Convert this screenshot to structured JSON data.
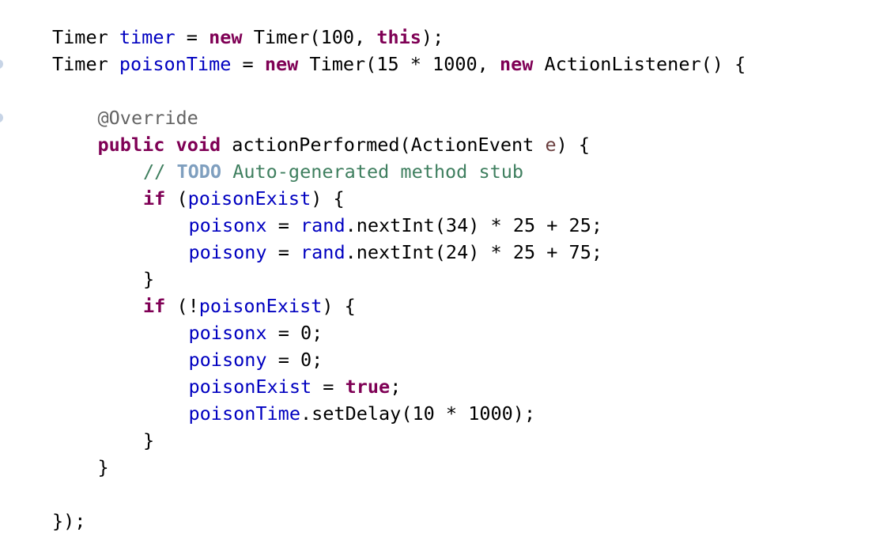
{
  "editor": {
    "lines": [
      {
        "indent": 0,
        "tokens": [
          {
            "t": "Timer ",
            "k": "plain"
          },
          {
            "t": "timer",
            "k": "field"
          },
          {
            "t": " = ",
            "k": "plain"
          },
          {
            "t": "new",
            "k": "kw"
          },
          {
            "t": " Timer(100, ",
            "k": "plain"
          },
          {
            "t": "this",
            "k": "kw"
          },
          {
            "t": ");",
            "k": "plain"
          }
        ]
      },
      {
        "indent": 0,
        "tokens": [
          {
            "t": "Timer ",
            "k": "plain"
          },
          {
            "t": "poisonTime",
            "k": "field"
          },
          {
            "t": " = ",
            "k": "plain"
          },
          {
            "t": "new",
            "k": "kw"
          },
          {
            "t": " Timer(15 * 1000, ",
            "k": "plain"
          },
          {
            "t": "new",
            "k": "kw"
          },
          {
            "t": " ActionListener() {",
            "k": "plain"
          }
        ]
      },
      {
        "indent": 0,
        "tokens": []
      },
      {
        "indent": 1,
        "tokens": [
          {
            "t": "@Override",
            "k": "ann"
          }
        ]
      },
      {
        "indent": 1,
        "tokens": [
          {
            "t": "public",
            "k": "kw"
          },
          {
            "t": " ",
            "k": "plain"
          },
          {
            "t": "void",
            "k": "kw"
          },
          {
            "t": " actionPerformed(ActionEvent ",
            "k": "plain"
          },
          {
            "t": "e",
            "k": "param"
          },
          {
            "t": ") {",
            "k": "plain"
          }
        ]
      },
      {
        "indent": 2,
        "tokens": [
          {
            "t": "// ",
            "k": "comment"
          },
          {
            "t": "TODO",
            "k": "todo"
          },
          {
            "t": " Auto-generated method stub",
            "k": "comment"
          }
        ]
      },
      {
        "indent": 2,
        "tokens": [
          {
            "t": "if",
            "k": "kw"
          },
          {
            "t": " (",
            "k": "plain"
          },
          {
            "t": "poisonExist",
            "k": "field"
          },
          {
            "t": ") {",
            "k": "plain"
          }
        ]
      },
      {
        "indent": 3,
        "tokens": [
          {
            "t": "poisonx",
            "k": "field"
          },
          {
            "t": " = ",
            "k": "plain"
          },
          {
            "t": "rand",
            "k": "field"
          },
          {
            "t": ".nextInt(34) * 25 + 25;",
            "k": "plain"
          }
        ]
      },
      {
        "indent": 3,
        "tokens": [
          {
            "t": "poisony",
            "k": "field"
          },
          {
            "t": " = ",
            "k": "plain"
          },
          {
            "t": "rand",
            "k": "field"
          },
          {
            "t": ".nextInt(24) * 25 + 75;",
            "k": "plain"
          }
        ]
      },
      {
        "indent": 2,
        "tokens": [
          {
            "t": "}",
            "k": "plain"
          }
        ]
      },
      {
        "indent": 2,
        "tokens": [
          {
            "t": "if",
            "k": "kw"
          },
          {
            "t": " (!",
            "k": "plain"
          },
          {
            "t": "poisonExist",
            "k": "field"
          },
          {
            "t": ") {",
            "k": "plain"
          }
        ]
      },
      {
        "indent": 3,
        "tokens": [
          {
            "t": "poisonx",
            "k": "field"
          },
          {
            "t": " = 0;",
            "k": "plain"
          }
        ]
      },
      {
        "indent": 3,
        "tokens": [
          {
            "t": "poisony",
            "k": "field"
          },
          {
            "t": " = 0;",
            "k": "plain"
          }
        ]
      },
      {
        "indent": 3,
        "tokens": [
          {
            "t": "poisonExist",
            "k": "field"
          },
          {
            "t": " = ",
            "k": "plain"
          },
          {
            "t": "true",
            "k": "kw"
          },
          {
            "t": ";",
            "k": "plain"
          }
        ]
      },
      {
        "indent": 3,
        "tokens": [
          {
            "t": "poisonTime",
            "k": "field"
          },
          {
            "t": ".setDelay(10 * 1000);",
            "k": "plain"
          }
        ]
      },
      {
        "indent": 2,
        "tokens": [
          {
            "t": "}",
            "k": "plain"
          }
        ]
      },
      {
        "indent": 1,
        "tokens": [
          {
            "t": "}",
            "k": "plain"
          }
        ]
      },
      {
        "indent": 0,
        "tokens": []
      },
      {
        "indent": 0,
        "tokens": [
          {
            "t": "});",
            "k": "plain"
          }
        ]
      }
    ]
  },
  "colors": {
    "background": "#ffffff",
    "plain": "#000000",
    "keyword": "#7f0055",
    "field": "#0000c0",
    "parameter": "#6a3e3e",
    "annotation": "#646464",
    "comment": "#3f7f5f",
    "todo": "#7f9fbf",
    "gutter_marker": "#c7d4e6"
  }
}
